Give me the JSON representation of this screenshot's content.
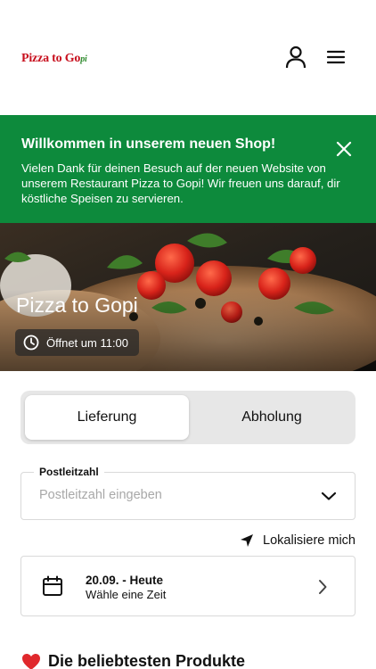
{
  "header": {
    "logo_text": "Pizza to Go",
    "logo_suffix": "pi",
    "user_icon": "user-icon",
    "menu_icon": "hamburger-menu-icon"
  },
  "banner": {
    "title": "Willkommen in unserem neuen Shop!",
    "text": "Vielen Dank für deinen Besuch auf der neuen Website von unserem Restaurant Pizza to Gopi! Wir freuen uns darauf, dir köstliche Speisen zu servieren.",
    "close_icon": "close-icon",
    "color": "#0d8a3c"
  },
  "hero": {
    "title": "Pizza to Gopi",
    "hours": "Öffnet um 11:00",
    "clock_icon": "clock-icon"
  },
  "order_mode": {
    "options": [
      "Lieferung",
      "Abholung"
    ],
    "selected": "Lieferung"
  },
  "postcode": {
    "label": "Postleitzahl",
    "placeholder": "Postleitzahl eingeben",
    "value": ""
  },
  "locate": {
    "label": "Lokalisiere mich",
    "icon": "location-arrow-icon"
  },
  "date": {
    "title": "20.09. - Heute",
    "subtitle": "Wähle eine Zeit",
    "icon": "calendar-icon"
  },
  "popular": {
    "emoji": "❤️",
    "title": "Die beliebtesten Produkte"
  }
}
